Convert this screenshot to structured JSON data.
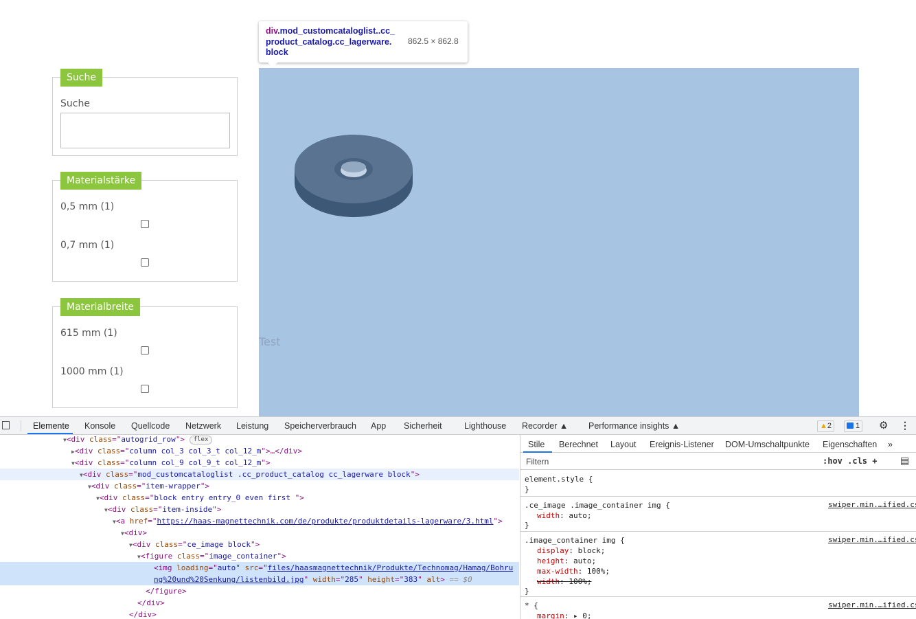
{
  "filters": {
    "search": {
      "legend": "Suche",
      "label": "Suche",
      "value": ""
    },
    "thickness": {
      "legend": "Materialstärke",
      "options": [
        {
          "label": "0,5 mm (1)",
          "checked": false
        },
        {
          "label": "0,7 mm (1)",
          "checked": false
        }
      ]
    },
    "width": {
      "legend": "Materialbreite",
      "options": [
        {
          "label": "615 mm (1)",
          "checked": false
        },
        {
          "label": "1000 mm (1)",
          "checked": false
        }
      ]
    }
  },
  "product": {
    "caption": "Test"
  },
  "tooltip": {
    "tag": "div",
    "classes": ".mod_customcataloglist..cc_ product_catalog.cc_lagerware. block",
    "size": "862.5 × 862.8"
  },
  "devtools": {
    "tabs": [
      "Elemente",
      "Konsole",
      "Quellcode",
      "Netzwerk",
      "Leistung",
      "Speicherverbrauch",
      "App",
      "Sicherheit",
      "Lighthouse",
      "Recorder",
      "Performance insights"
    ],
    "active_tab": "Elemente",
    "warnings": "2",
    "messages": "1",
    "more": "⋮",
    "dom": {
      "l1_tag": "div",
      "l1_attr": "class",
      "l1_val": "autogrid_row",
      "l1_pill": "flex",
      "l2_tag": "div",
      "l2_attr": "class",
      "l2_val": "column col_3 col_3_t col_12_m",
      "l2_rest": ">…</div>",
      "l3_tag": "div",
      "l3_attr": "class",
      "l3_val": "column col_9 col_9_t col_12_m",
      "l4_tag": "div",
      "l4_attr": "class",
      "l4_val": "mod_customcataloglist .cc_product_catalog cc_lagerware block",
      "l5_tag": "div",
      "l5_attr": "class",
      "l5_val": "item-wrapper",
      "l6_tag": "div",
      "l6_attr": "class",
      "l6_val": "block entry entry_0 even first ",
      "l7_tag": "div",
      "l7_attr": "class",
      "l7_val": "item-inside",
      "l8_tag": "a",
      "l8_attr": "href",
      "l8_val": "https://haas-magnettechnik.com/de/produkte/produktdetails-lagerware/3.html",
      "l9_tag": "div",
      "l10_tag": "div",
      "l10_attr": "class",
      "l10_val": "ce_image block",
      "l11_tag": "figure",
      "l11_attr": "class",
      "l11_val": "image_container",
      "l12_tag": "img",
      "l12_a1": "loading",
      "l12_v1": "auto",
      "l12_a2": "src",
      "l12_src1": "files/haasmagnettechnik/Produkte/Technomag/Hamag/Bohru",
      "l12_src2": "ng%20und%20Senkung/listenbild.jpg",
      "l12_a3": "width",
      "l12_v3": "285",
      "l12_a4": "height",
      "l12_v4": "383",
      "l12_a5": "alt",
      "l12_eq": "== $0",
      "l13": "</figure>",
      "l14": "</div>",
      "l15": "</div>"
    },
    "styles": {
      "tabs": [
        "Stile",
        "Berechnet",
        "Layout",
        "Ereignis-Listener",
        "DOM-Umschaltpunkte",
        "Eigenschaften",
        "»"
      ],
      "filter_placeholder": "Filtern",
      "filter_tools": ":hov  .cls  +",
      "rules": {
        "r0_sel": "element.style {",
        "r0_end": "}",
        "r1_sel": ".ce_image .image_container img {",
        "r1_src": "swiper.min.…ified.css",
        "r1_p1": "width",
        "r1_v1": "auto;",
        "r1_end": "}",
        "r2_sel": ".image_container img {",
        "r2_src": "swiper.min.…ified.css",
        "r2_p1": "display",
        "r2_v1": "block;",
        "r2_p2": "height",
        "r2_v2": "auto;",
        "r2_p3": "max-width",
        "r2_v3": "100%;",
        "r2_p4": "width",
        "r2_v4": "100%;",
        "r2_end": "}",
        "r3_sel": "* {",
        "r3_src": "swiper.min.…ified.css",
        "r3_p1": "margin",
        "r3_v1": "▸ 0;"
      }
    }
  },
  "colors": {
    "legend_green": "#8cc63f",
    "highlight_overlay": "#a8c4e3",
    "devtools_blue": "#1a73e8"
  }
}
